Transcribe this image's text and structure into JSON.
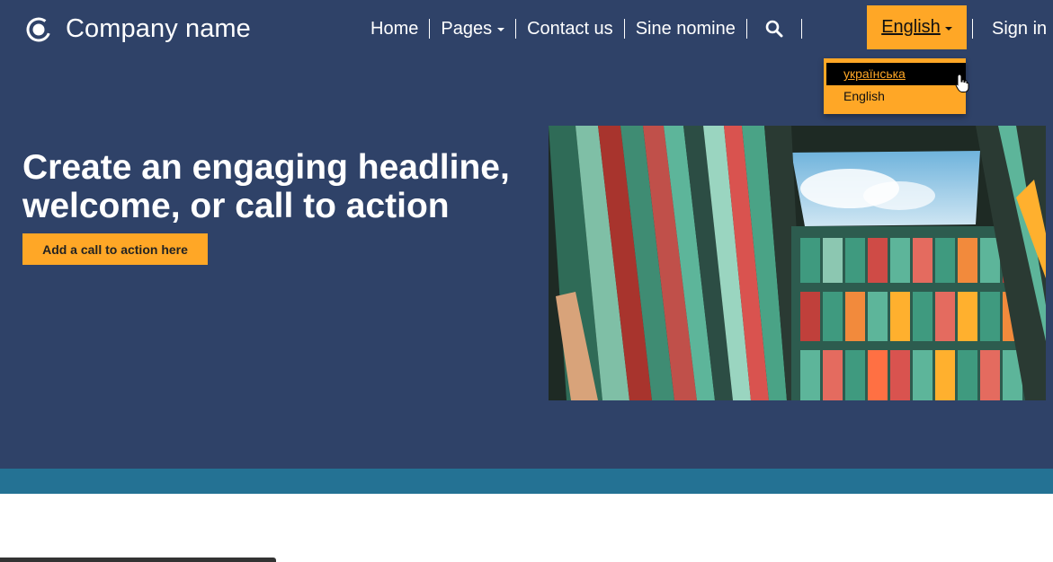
{
  "brand": {
    "name": "Company name",
    "logo_icon": "circle-logo-icon"
  },
  "nav": {
    "home": "Home",
    "pages": "Pages",
    "contact": "Contact us",
    "sine": "Sine nomine",
    "search_icon": "search-icon",
    "language": "English",
    "signin": "Sign in"
  },
  "language_menu": {
    "items": [
      "українська",
      "English"
    ],
    "active_index": 0
  },
  "hero": {
    "headline_line1": "Create an engaging headline,",
    "headline_line2": "welcome, or call to action",
    "cta": "Add a call to action here",
    "image_icon": "colorful-building-image"
  },
  "colors": {
    "navy": "#2f4268",
    "accent": "#ffa726",
    "band": "#247294",
    "dropdown_active_bg": "#000000"
  }
}
